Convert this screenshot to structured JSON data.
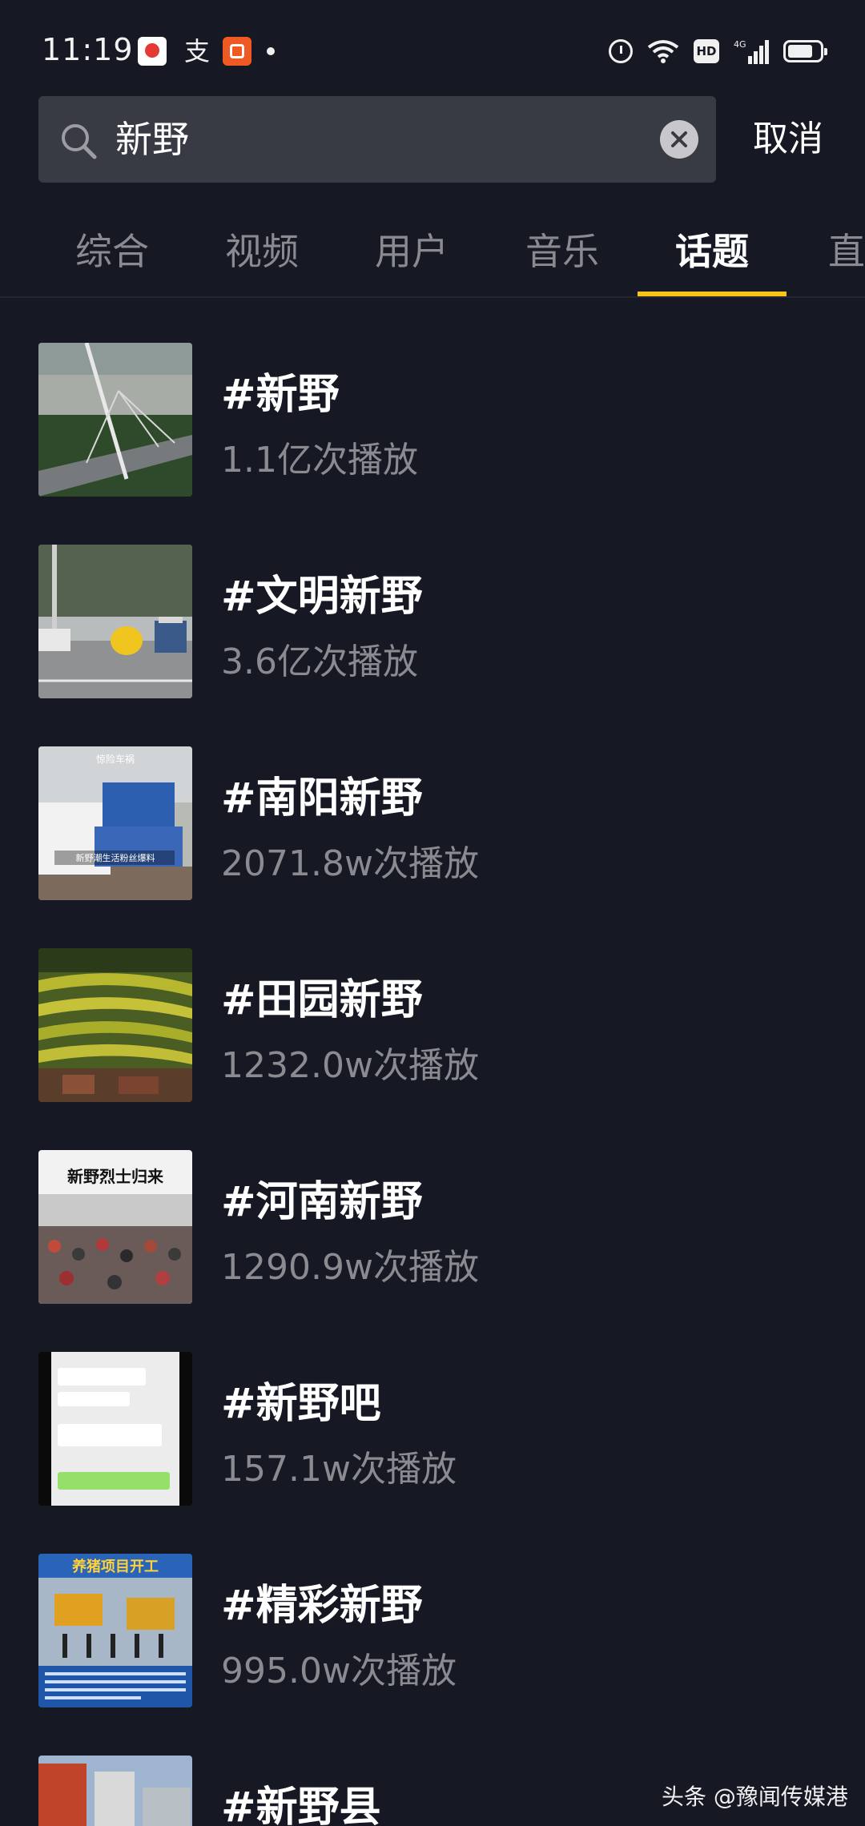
{
  "status_bar": {
    "time": "11:19",
    "notif_symbol": "支",
    "network": "4G",
    "hd_label": "HD"
  },
  "search": {
    "query": "新野",
    "cancel_label": "取消"
  },
  "tabs": [
    "综合",
    "视频",
    "用户",
    "音乐",
    "话题",
    "直"
  ],
  "active_tab": "话题",
  "topics": [
    {
      "title": "#新野",
      "plays": "1.1亿次播放"
    },
    {
      "title": "#文明新野",
      "plays": "3.6亿次播放"
    },
    {
      "title": "#南阳新野",
      "plays": "2071.8w次播放",
      "thumb_caption": "新野潮生活粉丝爆料",
      "thumb_banner": "惊险车祸"
    },
    {
      "title": "#田园新野",
      "plays": "1232.0w次播放"
    },
    {
      "title": "#河南新野",
      "plays": "1290.9w次播放",
      "thumb_caption": "新野烈士归来"
    },
    {
      "title": "#新野吧",
      "plays": "157.1w次播放"
    },
    {
      "title": "#精彩新野",
      "plays": "995.0w次播放",
      "thumb_caption": "养猪项目开工"
    },
    {
      "title": "#新野县",
      "plays": ""
    }
  ],
  "watermark": "头条 @豫闻传媒港",
  "colors": {
    "background": "#161823",
    "accent": "#f5c518",
    "muted_text": "#8a8b91",
    "search_bg": "#393b44"
  }
}
